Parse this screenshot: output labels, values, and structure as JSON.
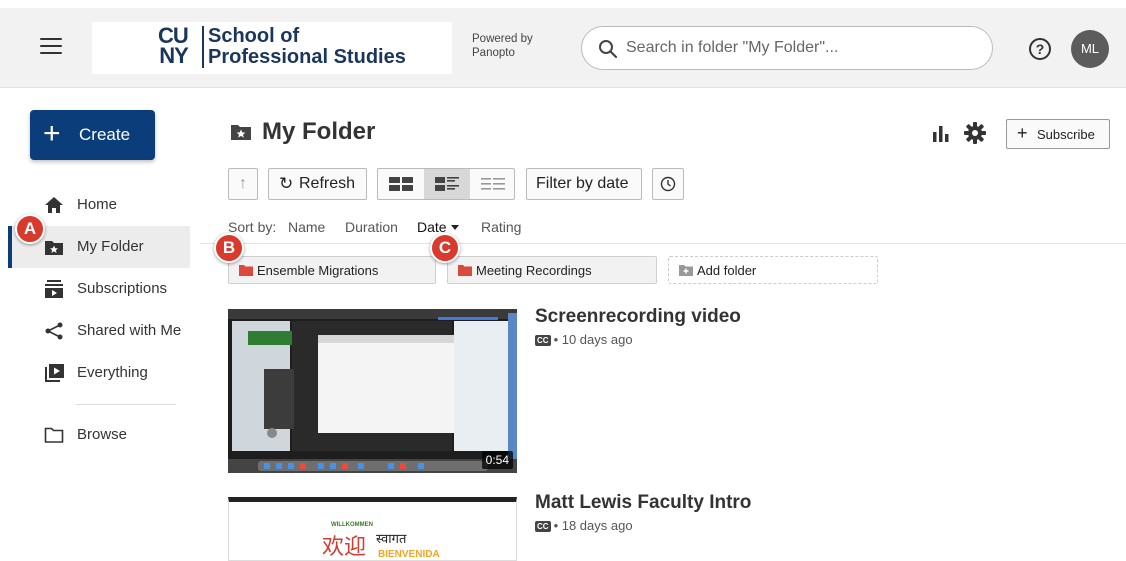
{
  "header": {
    "logo_cuny": [
      "CU",
      "NY"
    ],
    "logo_school_line1": "School of",
    "logo_school_line2": "Professional Studies",
    "powered_line1": "Powered by",
    "powered_line2": "Panopto",
    "search_placeholder": "Search in folder \"My Folder\"...",
    "help_label": "?",
    "avatar_initials": "ML"
  },
  "sidebar": {
    "create_label": "Create",
    "items": [
      {
        "label": "Home",
        "icon": "home-icon"
      },
      {
        "label": "My Folder",
        "icon": "star-folder-icon",
        "active": true
      },
      {
        "label": "Subscriptions",
        "icon": "subscriptions-icon"
      },
      {
        "label": "Shared with Me",
        "icon": "share-icon"
      },
      {
        "label": "Everything",
        "icon": "play-stack-icon"
      },
      {
        "label": "Browse",
        "icon": "folder-outline-icon"
      }
    ]
  },
  "markers": {
    "a": "A",
    "b": "B",
    "c": "C"
  },
  "main": {
    "title": "My Folder",
    "subscribe_label": "Subscribe",
    "toolbar": {
      "up_label": "↑",
      "refresh_label": "Refresh",
      "filter_label": "Filter by date"
    },
    "sort": {
      "label": "Sort by:",
      "options": [
        "Name",
        "Duration",
        "Date",
        "Rating"
      ],
      "active": "Date"
    },
    "folders": [
      {
        "label": "Ensemble Migrations"
      },
      {
        "label": "Meeting Recordings"
      }
    ],
    "add_folder_label": "Add folder",
    "videos": [
      {
        "title": "Screenrecording video",
        "meta": "• 10 days ago",
        "duration": "0:54",
        "cc": "CC"
      },
      {
        "title": "Matt Lewis Faculty Intro",
        "meta": "• 18 days ago",
        "cc": "CC",
        "thumb_words": [
          "WILLKOMMEN",
          "欢迎",
          "स्वागत",
          "BIENVENIDA"
        ]
      }
    ]
  },
  "colors": {
    "brand": "#0b3d7a",
    "marker": "#d83a2e",
    "cuny_blue": "#1b365d"
  }
}
